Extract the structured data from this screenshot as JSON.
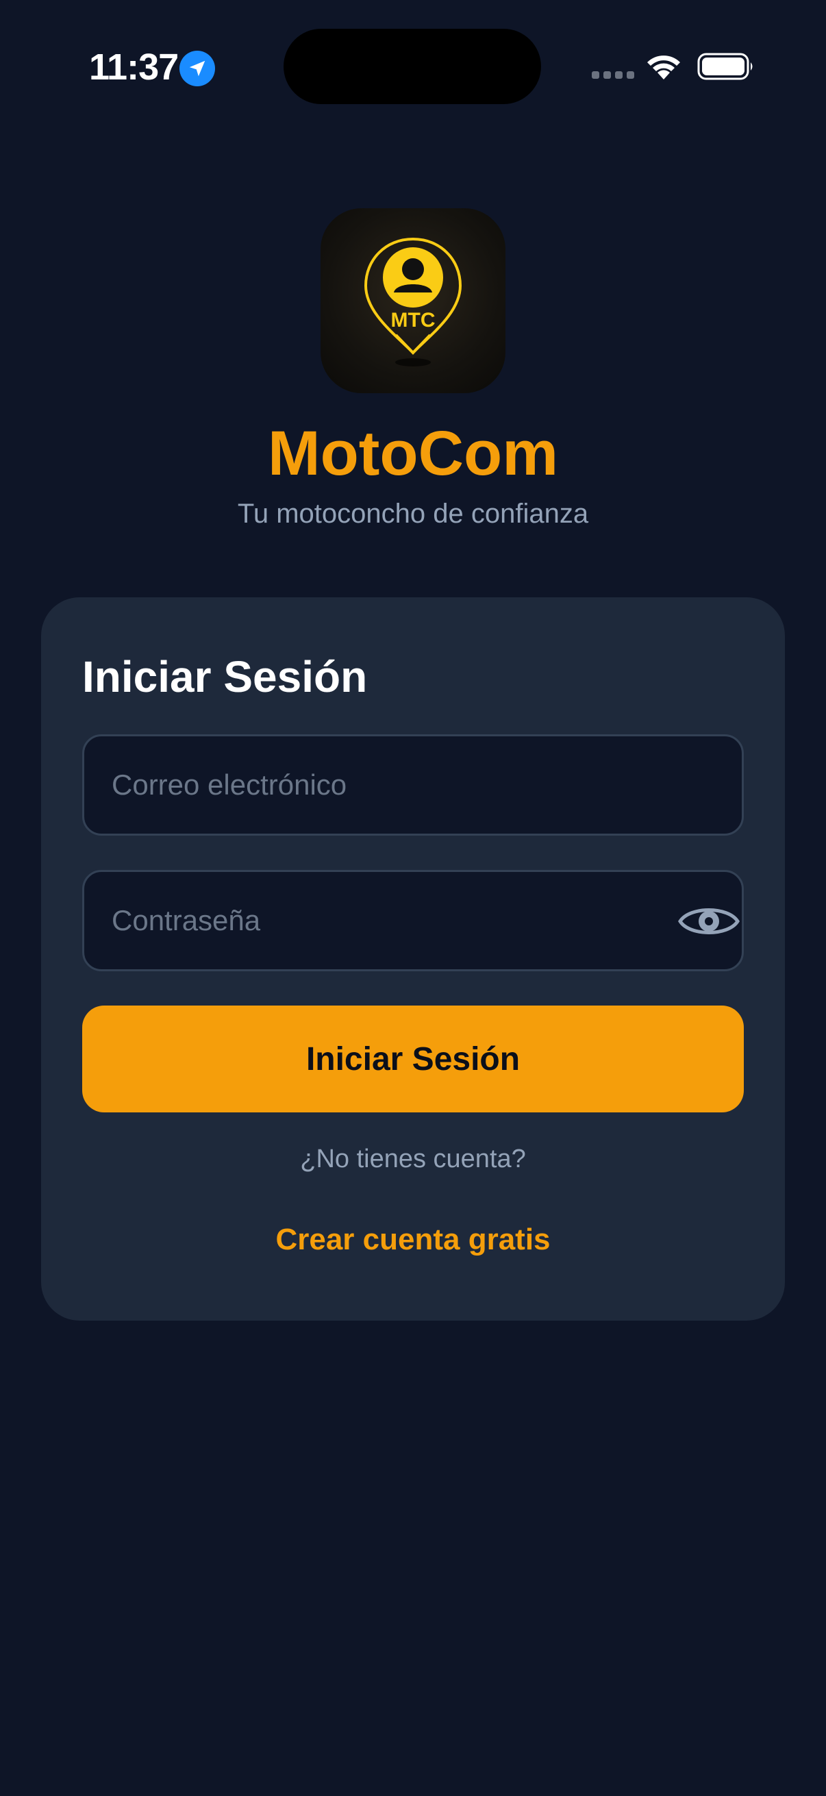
{
  "status_bar": {
    "time": "11:37",
    "icons": [
      "location-arrow-icon",
      "cellular-signal-icon",
      "wifi-icon",
      "battery-icon"
    ]
  },
  "brand": {
    "logo_text": "MTC",
    "name": "MotoCom",
    "tagline": "Tu motoconcho de confianza"
  },
  "login_form": {
    "title": "Iniciar Sesión",
    "email_placeholder": "Correo electrónico",
    "email_value": "",
    "password_placeholder": "Contraseña",
    "password_value": "",
    "submit_label": "Iniciar Sesión",
    "no_account_text": "¿No tienes cuenta?",
    "create_account_label": "Crear cuenta gratis"
  },
  "colors": {
    "background": "#0e1527",
    "card": "#1e293b",
    "accent": "#f59e0b",
    "muted_text": "#94a3b8"
  }
}
